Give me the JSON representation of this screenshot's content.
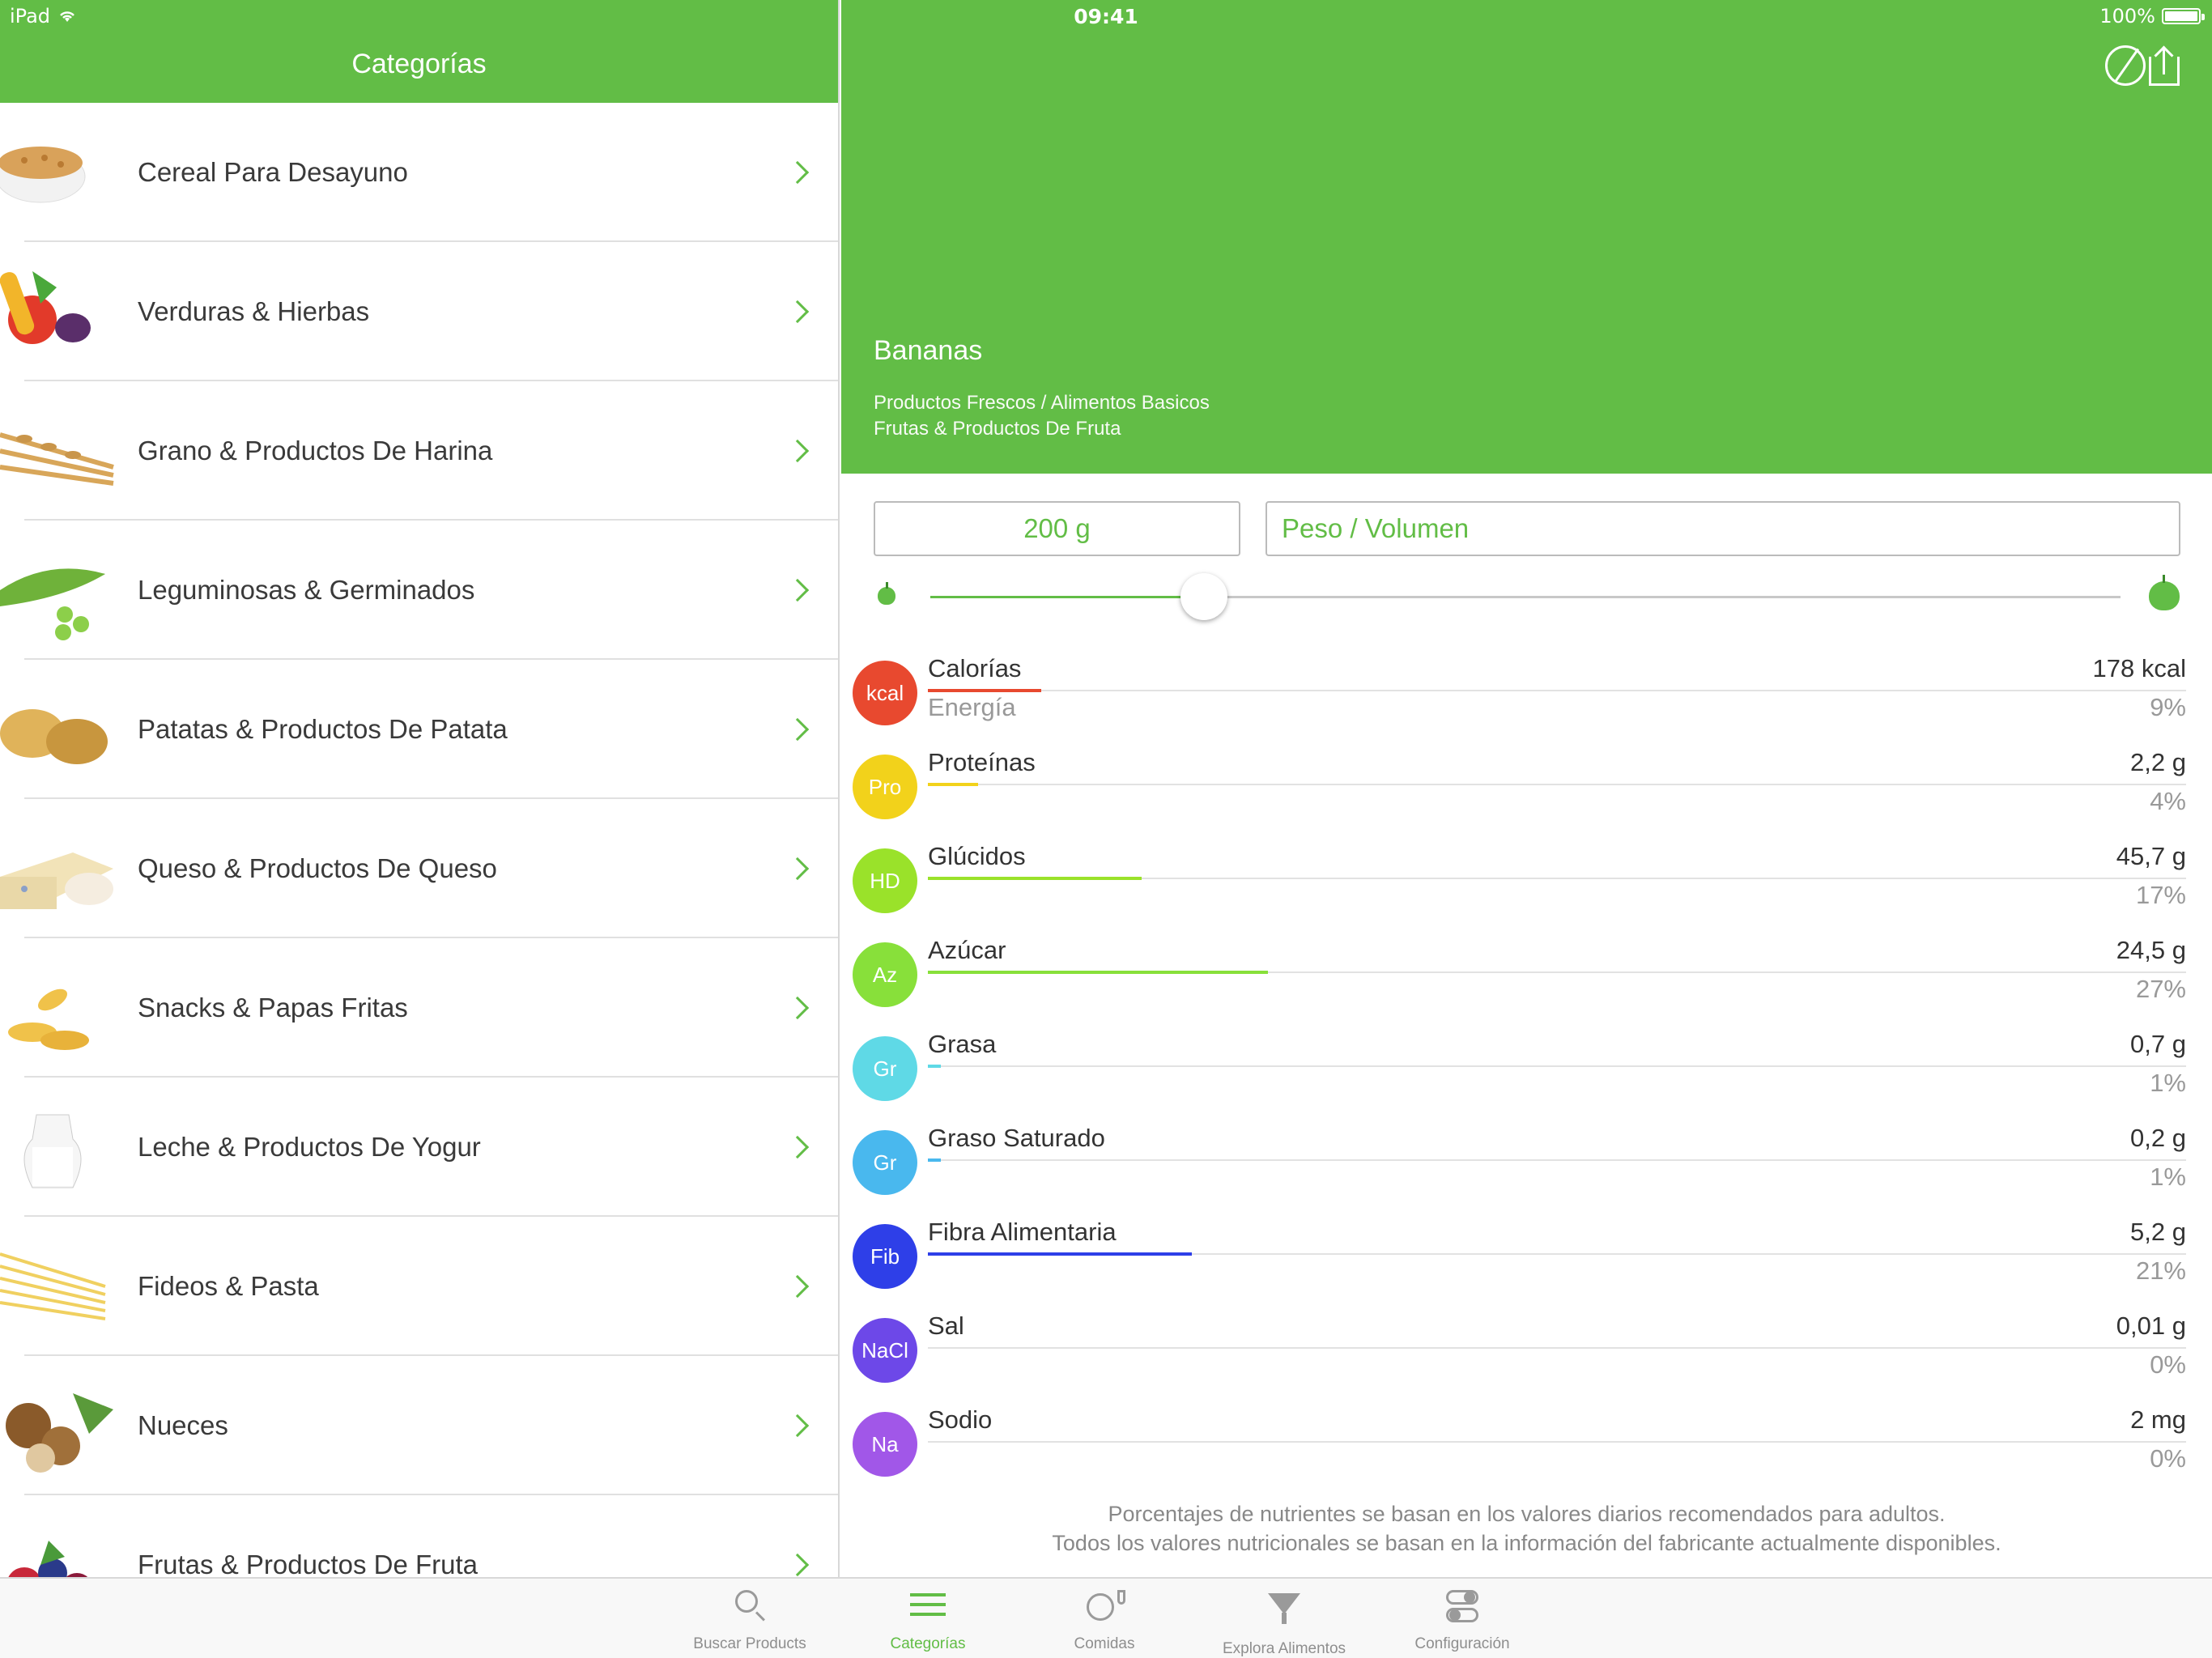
{
  "status_bar": {
    "device": "iPad",
    "time": "09:41",
    "battery": "100%"
  },
  "left": {
    "title": "Categorías",
    "categories": [
      {
        "label": "Cereal Para Desayuno",
        "icon": "cereal-bowl-photo"
      },
      {
        "label": "Verduras & Hierbas",
        "icon": "vegetables-photo"
      },
      {
        "label": "Grano & Productos De Harina",
        "icon": "wheat-photo"
      },
      {
        "label": "Leguminosas & Germinados",
        "icon": "peas-photo"
      },
      {
        "label": "Patatas & Productos De Patata",
        "icon": "potatoes-photo"
      },
      {
        "label": "Queso & Productos De Queso",
        "icon": "cheese-photo"
      },
      {
        "label": "Snacks & Papas Fritas",
        "icon": "chips-photo"
      },
      {
        "label": "Leche & Productos De Yogur",
        "icon": "milk-jug-photo"
      },
      {
        "label": "Fideos & Pasta",
        "icon": "spaghetti-photo"
      },
      {
        "label": "Nueces",
        "icon": "hazelnuts-photo"
      },
      {
        "label": "Frutas & Productos De Fruta",
        "icon": "berries-photo"
      }
    ]
  },
  "detail": {
    "food_name": "Bananas",
    "path_line1": "Productos Frescos / Alimentos Basicos",
    "path_line2": "Frutas & Productos De Fruta",
    "amount": "200 g",
    "unit_placeholder": "Peso / Volumen",
    "slider_fraction": 0.23,
    "nutrients": [
      {
        "badge": "kcal",
        "name": "Calorías",
        "sub": "Energía",
        "value": "178 kcal",
        "pct": "9%",
        "fraction": 0.09,
        "color": "#e8492f"
      },
      {
        "badge": "Pro",
        "name": "Proteínas",
        "sub": "",
        "value": "2,2 g",
        "pct": "4%",
        "fraction": 0.04,
        "color": "#f2d21b"
      },
      {
        "badge": "HD",
        "name": "Glúcidos",
        "sub": "",
        "value": "45,7 g",
        "pct": "17%",
        "fraction": 0.17,
        "color": "#9ae22a"
      },
      {
        "badge": "Az",
        "name": "Azúcar",
        "sub": "",
        "value": "24,5 g",
        "pct": "27%",
        "fraction": 0.27,
        "color": "#88e03a"
      },
      {
        "badge": "Gr",
        "name": "Grasa",
        "sub": "",
        "value": "0,7 g",
        "pct": "1%",
        "fraction": 0.01,
        "color": "#5fd9e6"
      },
      {
        "badge": "Gr",
        "name": "Graso Saturado",
        "sub": "",
        "value": "0,2 g",
        "pct": "1%",
        "fraction": 0.01,
        "color": "#49b8ee"
      },
      {
        "badge": "Fib",
        "name": "Fibra Alimentaria",
        "sub": "",
        "value": "5,2 g",
        "pct": "21%",
        "fraction": 0.21,
        "color": "#2e3fe8"
      },
      {
        "badge": "NaCl",
        "name": "Sal",
        "sub": "",
        "value": "0,01 g",
        "pct": "0%",
        "fraction": 0.0,
        "color": "#6d48e8"
      },
      {
        "badge": "Na",
        "name": "Sodio",
        "sub": "",
        "value": "2 mg",
        "pct": "0%",
        "fraction": 0.0,
        "color": "#a157e8"
      }
    ],
    "footnote_line1": "Porcentajes de nutrientes se basan en los valores diarios recomendados para adultos.",
    "footnote_line2": "Todos los valores nutricionales se basan en la información del fabricante actualmente disponibles."
  },
  "tabbar": {
    "tabs": [
      {
        "label": "Buscar Products",
        "icon": "search-icon",
        "active": false
      },
      {
        "label": "Categorías",
        "icon": "list-icon",
        "active": true
      },
      {
        "label": "Comidas",
        "icon": "plate-glass-icon",
        "active": false
      },
      {
        "label": "Explora Alimentos",
        "icon": "funnel-icon",
        "active": false
      },
      {
        "label": "Configuración",
        "icon": "toggles-icon",
        "active": false
      }
    ]
  },
  "colors": {
    "brand_green": "#62bd46"
  }
}
